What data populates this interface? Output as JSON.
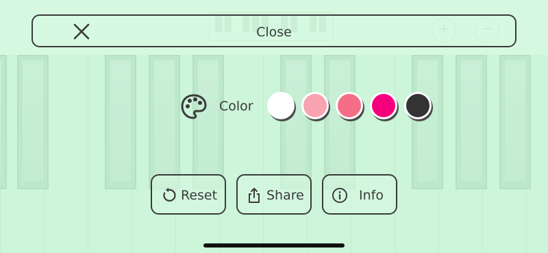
{
  "close_bar": {
    "label": "Close"
  },
  "color_picker": {
    "label": "Color",
    "swatches": [
      "#ffffff",
      "#f9a3b0",
      "#f46f86",
      "#f5007d",
      "#333333"
    ]
  },
  "actions": {
    "reset_label": "Reset",
    "share_label": "Share",
    "info_label": "Info"
  },
  "theme": {
    "background": "#ccf5d9",
    "outline": "#3a3a3a"
  }
}
